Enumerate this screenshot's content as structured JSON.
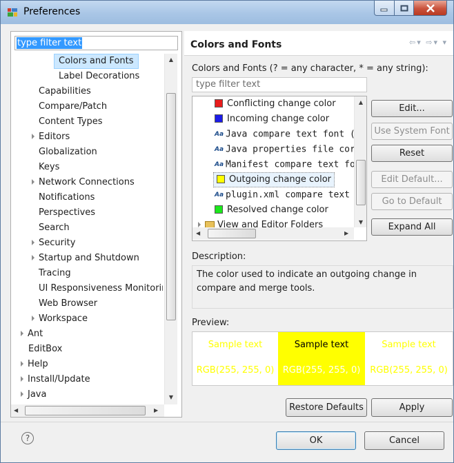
{
  "window": {
    "title": "Preferences"
  },
  "left": {
    "filter_value": "type filter text",
    "tree": [
      {
        "label": "Colors and Fonts",
        "level": 3,
        "selected": true
      },
      {
        "label": "Label Decorations",
        "level": 3
      },
      {
        "label": "Capabilities",
        "level": 2
      },
      {
        "label": "Compare/Patch",
        "level": 2
      },
      {
        "label": "Content Types",
        "level": 2
      },
      {
        "label": "Editors",
        "level": 2,
        "expandable": true
      },
      {
        "label": "Globalization",
        "level": 2
      },
      {
        "label": "Keys",
        "level": 2
      },
      {
        "label": "Network Connections",
        "level": 2,
        "expandable": true
      },
      {
        "label": "Notifications",
        "level": 2
      },
      {
        "label": "Perspectives",
        "level": 2
      },
      {
        "label": "Search",
        "level": 2
      },
      {
        "label": "Security",
        "level": 2,
        "expandable": true
      },
      {
        "label": "Startup and Shutdown",
        "level": 2,
        "expandable": true
      },
      {
        "label": "Tracing",
        "level": 2
      },
      {
        "label": "UI Responsiveness Monitorin",
        "level": 2
      },
      {
        "label": "Web Browser",
        "level": 2
      },
      {
        "label": "Workspace",
        "level": 2,
        "expandable": true
      },
      {
        "label": "Ant",
        "level": 1,
        "expandable": true
      },
      {
        "label": "EditBox",
        "level": 1
      },
      {
        "label": "Help",
        "level": 1,
        "expandable": true
      },
      {
        "label": "Install/Update",
        "level": 1,
        "expandable": true
      },
      {
        "label": "Java",
        "level": 1,
        "expandable": true
      }
    ]
  },
  "right": {
    "title": "Colors and Fonts",
    "filter_label": "Colors and Fonts (? = any character, * = any string):",
    "filter_placeholder": "type filter text",
    "items": [
      {
        "label": "Conflicting change color",
        "kind": "color",
        "color": "#e81c1c"
      },
      {
        "label": "Incoming change color",
        "kind": "color",
        "color": "#1c1ce8"
      },
      {
        "label": "Java compare text font (",
        "kind": "font"
      },
      {
        "label": "Java properties file cor",
        "kind": "font"
      },
      {
        "label": "Manifest compare text fo",
        "kind": "font"
      },
      {
        "label": "Outgoing change color",
        "kind": "color",
        "color": "#ffff00",
        "selected": true
      },
      {
        "label": "plugin.xml compare text",
        "kind": "font"
      },
      {
        "label": "Resolved change color",
        "kind": "color",
        "color": "#1ce81c"
      },
      {
        "label": "View and Editor Folders",
        "kind": "folder"
      }
    ],
    "buttons": {
      "edit": "Edit...",
      "use_system_font": "Use System Font",
      "reset": "Reset",
      "edit_default": "Edit Default...",
      "go_to_default": "Go to Default",
      "expand_all": "Expand All"
    },
    "description_label": "Description:",
    "description_text": "The color used to indicate an outgoing change in compare and merge tools.",
    "preview_label": "Preview:",
    "preview": [
      {
        "sample": "Sample text",
        "rgb": "RGB(255, 255, 0)",
        "bg": "#ffffff",
        "sample_color": "#ffff00",
        "rgb_color": "#ffff00"
      },
      {
        "sample": "Sample text",
        "rgb": "RGB(255, 255, 0)",
        "bg": "#ffff00",
        "sample_color": "#000000",
        "rgb_color": "#ffffff"
      },
      {
        "sample": "Sample text",
        "rgb": "RGB(255, 255, 0)",
        "bg": "#ffffff",
        "sample_color": "#ffff00",
        "rgb_color": "#ffff00"
      }
    ],
    "restore_defaults": "Restore Defaults",
    "apply": "Apply"
  },
  "footer": {
    "ok": "OK",
    "cancel": "Cancel",
    "help": "?"
  }
}
